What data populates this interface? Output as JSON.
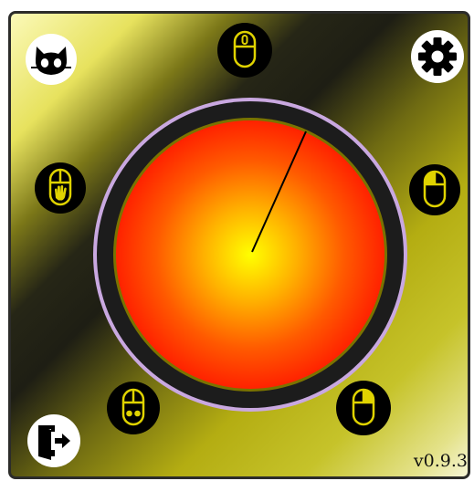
{
  "app": {
    "version": "v0.9.3"
  },
  "controls": {
    "github_icon": "cat-icon",
    "settings_icon": "gear-icon",
    "exit_icon": "exit-door-icon",
    "scroll_mouse_icon": "mouse-scroll-icon",
    "left_click_icon": "mouse-left-click-icon",
    "right_click_icon": "mouse-right-click-icon",
    "drag_icon": "mouse-drag-hand-icon",
    "double_click_icon": "mouse-double-click-icon"
  },
  "colors": {
    "dial_center": "#ffff00",
    "dial_edge": "#ff2200",
    "dial_ring": "#1a1a1a",
    "dial_outer_ring": "#c9a8e0",
    "accent_yellow": "#f0f000"
  }
}
